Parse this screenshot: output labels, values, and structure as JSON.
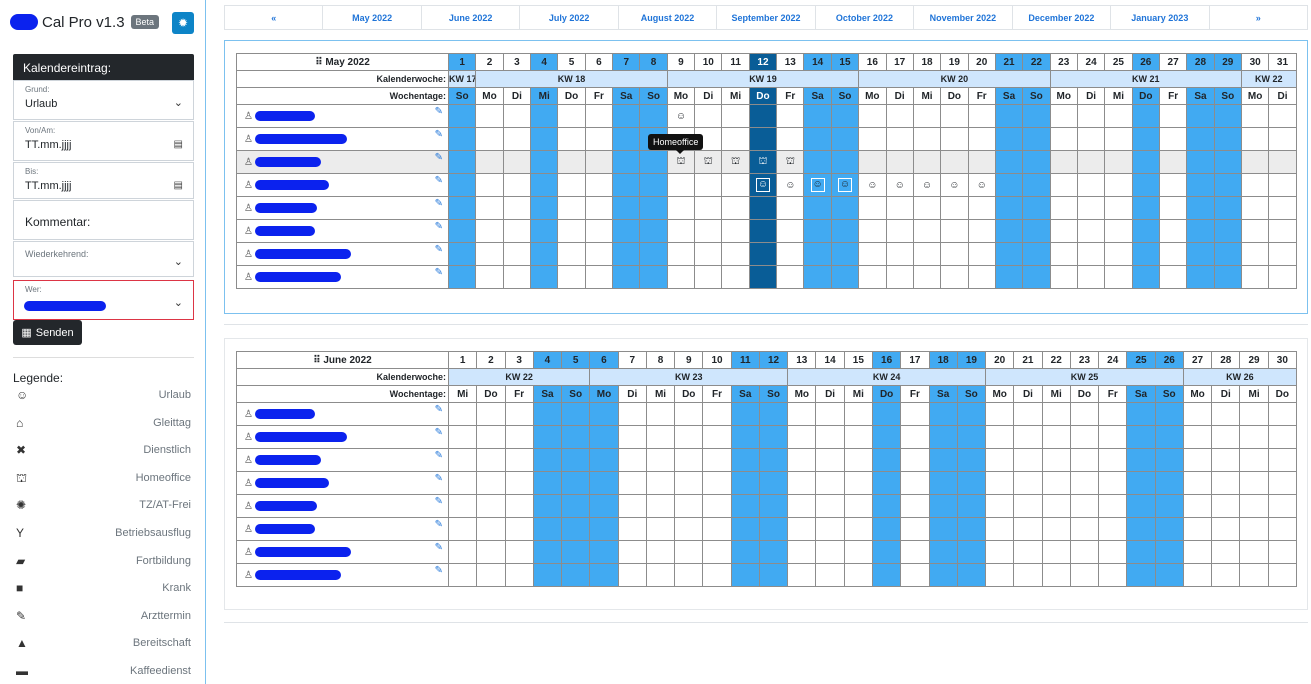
{
  "app": {
    "title": "Cal Pro v1.3",
    "badge": "Beta"
  },
  "form": {
    "header": "Kalendereintrag:",
    "grund": {
      "label": "Grund:",
      "value": "Urlaub"
    },
    "von": {
      "label": "Von/Am:",
      "value": "TT.mm.jjjj"
    },
    "bis": {
      "label": "Bis:",
      "value": "TT.mm.jjjj"
    },
    "kommentar": {
      "placeholder": "Kommentar:"
    },
    "wiederkehrend": {
      "label": "Wiederkehrend:"
    },
    "wer": {
      "label": "Wer:"
    },
    "submit": "Senden"
  },
  "legend": {
    "title": "Legende:",
    "items": [
      {
        "icon": "smiley-icon",
        "glyph": "☺",
        "label": "Urlaub"
      },
      {
        "icon": "home-icon",
        "glyph": "⌂",
        "label": "Gleittag"
      },
      {
        "icon": "tools-icon",
        "glyph": "✖",
        "label": "Dienstlich"
      },
      {
        "icon": "homeoffice-icon",
        "glyph": "⛫",
        "label": "Homeoffice"
      },
      {
        "icon": "virus-icon",
        "glyph": "✺",
        "label": "TZ/AT-Frei"
      },
      {
        "icon": "cocktail-icon",
        "glyph": "Y",
        "label": "Betriebsausflug"
      },
      {
        "icon": "graduation-cap-icon",
        "glyph": "▰",
        "label": "Fortbildung"
      },
      {
        "icon": "first-aid-icon",
        "glyph": "■",
        "label": "Krank"
      },
      {
        "icon": "syringe-icon",
        "glyph": "✎",
        "label": "Arzttermin"
      },
      {
        "icon": "bell-icon",
        "glyph": "▲",
        "label": "Bereitschaft"
      },
      {
        "icon": "coffee-icon",
        "glyph": "▬",
        "label": "Kaffeedienst"
      }
    ]
  },
  "nav": {
    "prev": "«",
    "next": "»",
    "months": [
      "May 2022",
      "June 2022",
      "July 2022",
      "August 2022",
      "September 2022",
      "October 2022",
      "November 2022",
      "December 2022",
      "January 2023"
    ]
  },
  "tooltip": "Homeoffice",
  "row_labels": {
    "kw": "Kalenderwoche:",
    "weekday": "Wochentage:"
  },
  "calendars": [
    {
      "title": "May 2022",
      "days": [
        "1",
        "2",
        "3",
        "4",
        "5",
        "6",
        "7",
        "8",
        "9",
        "10",
        "11",
        "12",
        "13",
        "14",
        "15",
        "16",
        "17",
        "18",
        "19",
        "20",
        "21",
        "22",
        "23",
        "24",
        "25",
        "26",
        "27",
        "28",
        "29",
        "30",
        "31"
      ],
      "weekdays": [
        "So",
        "Mo",
        "Di",
        "Mi",
        "Do",
        "Fr",
        "Sa",
        "So",
        "Mo",
        "Di",
        "Mi",
        "Do",
        "Fr",
        "Sa",
        "So",
        "Mo",
        "Di",
        "Mi",
        "Do",
        "Fr",
        "Sa",
        "So",
        "Mo",
        "Di",
        "Mi",
        "Do",
        "Fr",
        "Sa",
        "So",
        "Mo",
        "Di"
      ],
      "weekend": [
        0,
        6,
        7,
        13,
        14,
        20,
        21,
        27,
        28
      ],
      "highlight": [
        3,
        11,
        14,
        25
      ],
      "today": 11,
      "kw": [
        {
          "label": "KW 17",
          "span": 1
        },
        {
          "label": "KW 18",
          "span": 7
        },
        {
          "label": "KW 19",
          "span": 7
        },
        {
          "label": "KW 20",
          "span": 7
        },
        {
          "label": "KW 21",
          "span": 7
        },
        {
          "label": "KW 22",
          "span": 2
        }
      ],
      "people": 8,
      "hover_row": 2,
      "entries": [
        {
          "row": 0,
          "col": 8,
          "glyph": "☺"
        },
        {
          "row": 2,
          "col": 8,
          "glyph": "⛫"
        },
        {
          "row": 2,
          "col": 9,
          "glyph": "⛫"
        },
        {
          "row": 2,
          "col": 10,
          "glyph": "⛫"
        },
        {
          "row": 2,
          "col": 11,
          "glyph": "⛫"
        },
        {
          "row": 2,
          "col": 12,
          "glyph": "⛫"
        },
        {
          "row": 3,
          "col": 11,
          "glyph": "☺",
          "boxed": true
        },
        {
          "row": 3,
          "col": 12,
          "glyph": "☺"
        },
        {
          "row": 3,
          "col": 13,
          "glyph": "☺",
          "boxed": true
        },
        {
          "row": 3,
          "col": 14,
          "glyph": "☺",
          "boxed": true
        },
        {
          "row": 3,
          "col": 15,
          "glyph": "☺"
        },
        {
          "row": 3,
          "col": 16,
          "glyph": "☺"
        },
        {
          "row": 3,
          "col": 17,
          "glyph": "☺"
        },
        {
          "row": 3,
          "col": 18,
          "glyph": "☺"
        },
        {
          "row": 3,
          "col": 19,
          "glyph": "☺"
        }
      ]
    },
    {
      "title": "June 2022",
      "days": [
        "1",
        "2",
        "3",
        "4",
        "5",
        "6",
        "7",
        "8",
        "9",
        "10",
        "11",
        "12",
        "13",
        "14",
        "15",
        "16",
        "17",
        "18",
        "19",
        "20",
        "21",
        "22",
        "23",
        "24",
        "25",
        "26",
        "27",
        "28",
        "29",
        "30"
      ],
      "weekdays": [
        "Mi",
        "Do",
        "Fr",
        "Sa",
        "So",
        "Mo",
        "Di",
        "Mi",
        "Do",
        "Fr",
        "Sa",
        "So",
        "Mo",
        "Di",
        "Mi",
        "Do",
        "Fr",
        "Sa",
        "So",
        "Mo",
        "Di",
        "Mi",
        "Do",
        "Fr",
        "Sa",
        "So",
        "Mo",
        "Di",
        "Mi",
        "Do"
      ],
      "weekend": [
        3,
        4,
        10,
        11,
        17,
        18,
        24,
        25
      ],
      "highlight": [
        5,
        15
      ],
      "today": -1,
      "kw": [
        {
          "label": "KW 22",
          "span": 5
        },
        {
          "label": "KW 23",
          "span": 7
        },
        {
          "label": "KW 24",
          "span": 7
        },
        {
          "label": "KW 25",
          "span": 7
        },
        {
          "label": "KW 26",
          "span": 4
        }
      ],
      "people": 8,
      "hover_row": -1,
      "entries": []
    }
  ]
}
